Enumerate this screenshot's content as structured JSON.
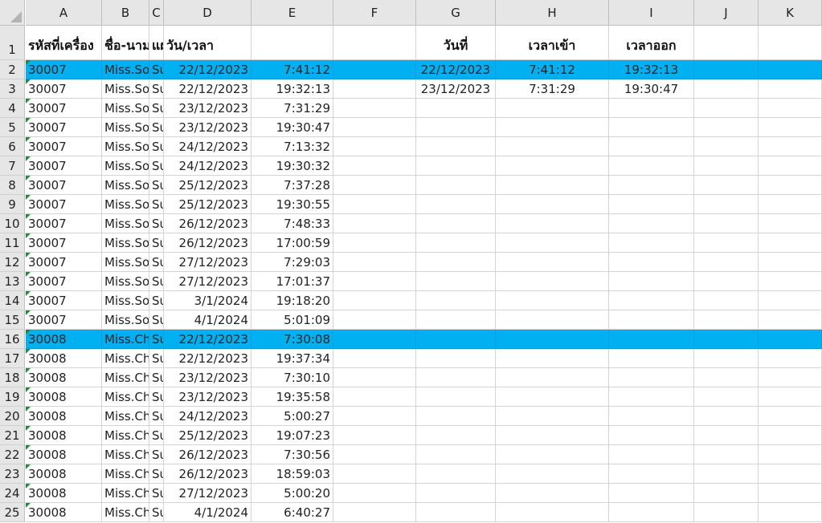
{
  "columns": [
    "A",
    "B",
    "C",
    "D",
    "E",
    "F",
    "G",
    "H",
    "I",
    "J",
    "K"
  ],
  "header_row": {
    "A": "รหัสที่เครื่อง",
    "B": "ชื่อ-นามสกุล",
    "C": "แผนก",
    "D": "วัน/เวลา",
    "G": "วันที่",
    "H": "เวลาเข้า",
    "I": "เวลาออก"
  },
  "rows": [
    {
      "id": "30007",
      "name": "Miss.So",
      "dept": "Su",
      "date": "22/12/2023",
      "time": "7:41:12",
      "highlight": true
    },
    {
      "id": "30007",
      "name": "Miss.So",
      "dept": "Su",
      "date": "22/12/2023",
      "time": "19:32:13",
      "highlight": false
    },
    {
      "id": "30007",
      "name": "Miss.So",
      "dept": "Su",
      "date": "23/12/2023",
      "time": "7:31:29",
      "highlight": false
    },
    {
      "id": "30007",
      "name": "Miss.So",
      "dept": "Su",
      "date": "23/12/2023",
      "time": "19:30:47",
      "highlight": false
    },
    {
      "id": "30007",
      "name": "Miss.So",
      "dept": "Su",
      "date": "24/12/2023",
      "time": "7:13:32",
      "highlight": false
    },
    {
      "id": "30007",
      "name": "Miss.So",
      "dept": "Su",
      "date": "24/12/2023",
      "time": "19:30:32",
      "highlight": false
    },
    {
      "id": "30007",
      "name": "Miss.So",
      "dept": "Su",
      "date": "25/12/2023",
      "time": "7:37:28",
      "highlight": false
    },
    {
      "id": "30007",
      "name": "Miss.So",
      "dept": "Su",
      "date": "25/12/2023",
      "time": "19:30:55",
      "highlight": false
    },
    {
      "id": "30007",
      "name": "Miss.So",
      "dept": "Su",
      "date": "26/12/2023",
      "time": "7:48:33",
      "highlight": false
    },
    {
      "id": "30007",
      "name": "Miss.So",
      "dept": "Su",
      "date": "26/12/2023",
      "time": "17:00:59",
      "highlight": false
    },
    {
      "id": "30007",
      "name": "Miss.So",
      "dept": "Su",
      "date": "27/12/2023",
      "time": "7:29:03",
      "highlight": false
    },
    {
      "id": "30007",
      "name": "Miss.So",
      "dept": "Su",
      "date": "27/12/2023",
      "time": "17:01:37",
      "highlight": false
    },
    {
      "id": "30007",
      "name": "Miss.So",
      "dept": "Su",
      "date": "3/1/2024",
      "time": "19:18:20",
      "highlight": false
    },
    {
      "id": "30007",
      "name": "Miss.So",
      "dept": "Su",
      "date": "4/1/2024",
      "time": "5:01:09",
      "highlight": false
    },
    {
      "id": "30008",
      "name": "Miss.Ch",
      "dept": "Su",
      "date": "22/12/2023",
      "time": "7:30:08",
      "highlight": true
    },
    {
      "id": "30008",
      "name": "Miss.Ch",
      "dept": "Su",
      "date": "22/12/2023",
      "time": "19:37:34",
      "highlight": false
    },
    {
      "id": "30008",
      "name": "Miss.Ch",
      "dept": "Su",
      "date": "23/12/2023",
      "time": "7:30:10",
      "highlight": false
    },
    {
      "id": "30008",
      "name": "Miss.Ch",
      "dept": "Su",
      "date": "23/12/2023",
      "time": "19:35:58",
      "highlight": false
    },
    {
      "id": "30008",
      "name": "Miss.Ch",
      "dept": "Su",
      "date": "24/12/2023",
      "time": "5:00:27",
      "highlight": false
    },
    {
      "id": "30008",
      "name": "Miss.Ch",
      "dept": "Su",
      "date": "25/12/2023",
      "time": "19:07:23",
      "highlight": false
    },
    {
      "id": "30008",
      "name": "Miss.Ch",
      "dept": "Su",
      "date": "26/12/2023",
      "time": "7:30:56",
      "highlight": false
    },
    {
      "id": "30008",
      "name": "Miss.Ch",
      "dept": "Su",
      "date": "26/12/2023",
      "time": "18:59:03",
      "highlight": false
    },
    {
      "id": "30008",
      "name": "Miss.Ch",
      "dept": "Su",
      "date": "27/12/2023",
      "time": "5:00:20",
      "highlight": false
    },
    {
      "id": "30008",
      "name": "Miss.Ch",
      "dept": "Su",
      "date": "4/1/2024",
      "time": "6:40:27",
      "highlight": false
    }
  ],
  "summary": [
    {
      "date": "22/12/2023",
      "in": "7:41:12",
      "out": "19:32:13"
    },
    {
      "date": "23/12/2023",
      "in": "7:31:29",
      "out": "19:30:47"
    }
  ],
  "colors": {
    "highlight": "#00b0f0",
    "header_bg": "#e6e6e6",
    "gridline": "#d4d4d4",
    "text_marker": "#1e8a3a"
  }
}
